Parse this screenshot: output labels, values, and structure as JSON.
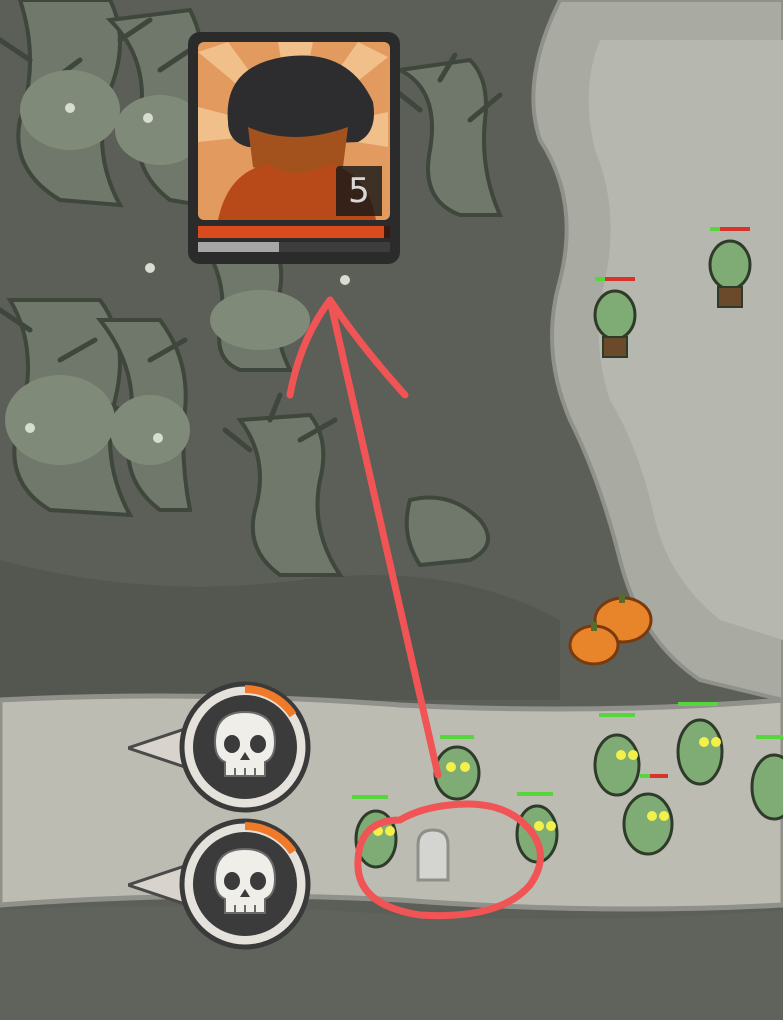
{
  "hero": {
    "level": "5",
    "health_fraction": 0.97,
    "xp_fraction": 0.42,
    "colors": {
      "frame": "#2b2b2b",
      "health": "#d94a1c",
      "xp": "#a6a6a6",
      "ray": "#e37a3f",
      "scarf": "#b84a1a"
    }
  },
  "wave_buttons": [
    {
      "icon": "skull-icon",
      "timer_fraction": 0.2
    },
    {
      "icon": "skull-icon",
      "timer_fraction": 0.2
    }
  ],
  "annotation": {
    "color": "#f05454"
  },
  "palette": {
    "ground": "#5b5f58",
    "road": "#bdbcb3",
    "path": "#a9aaa2",
    "tree": "#6f786b",
    "zombie": "#7fab74",
    "pumpkin": "#e8852a",
    "health_green": "#55d63d",
    "health_red": "#d8332a"
  }
}
